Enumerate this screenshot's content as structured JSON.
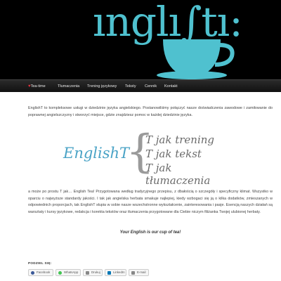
{
  "header": {
    "logo": "ınglı∫tı:"
  },
  "nav": {
    "items": [
      {
        "label": "Tea-time"
      },
      {
        "label": "Tłumaczenia"
      },
      {
        "label": "Trening językowy"
      },
      {
        "label": "Teksty"
      },
      {
        "label": "Cennik"
      },
      {
        "label": "Kontakt"
      }
    ]
  },
  "main": {
    "intro": "EnglishT to kompleksowe usługi w dziedzinie języka angielskiego. Postanowiliśmy połączyć nasze doświadczenia zawodowe i zamiłowanie do poprawnej angielszczyzny i stworzyć miejsce, gdzie znajdziesz pomoc w każdej dziedzinie języka.",
    "banner": {
      "brand": "EnglishT",
      "lines": [
        "T jak trening",
        "T jak tekst",
        "T jak tłumaczenia"
      ]
    },
    "body": "a może po prostu T jak… English Tea! Przygotowana według tradycyjnego przepisu, z dbałością o szczegóły i specyficzny klimat. Wszystko w oparciu o najwyższe standardy jakości. I tak jak angielska herbata smakuje najlepiej, kiedy wzbogaci się ją o kilka dodatków, zmieszanych w odpowiednich proporcjach, tak EnglishT słupia w sobie nasze wszechstronne wykształcenie, zainteresowania i pasje. Esencją naszych działań są warsztaty i kursy językowe, redakcja i korekta tekstów oraz tłumaczenia przygotowane dla Ciebie niczym filiżanka Twojej ulubionej herbaty.",
    "slogan": "Your English is our cup of tea!"
  },
  "share": {
    "title": "PODZIEL SIĘ:",
    "buttons": [
      {
        "label": "Facebook"
      },
      {
        "label": "WhatsApp"
      },
      {
        "label": "Drukuj"
      },
      {
        "label": "LinkedIn"
      },
      {
        "label": "E-mail"
      }
    ]
  }
}
